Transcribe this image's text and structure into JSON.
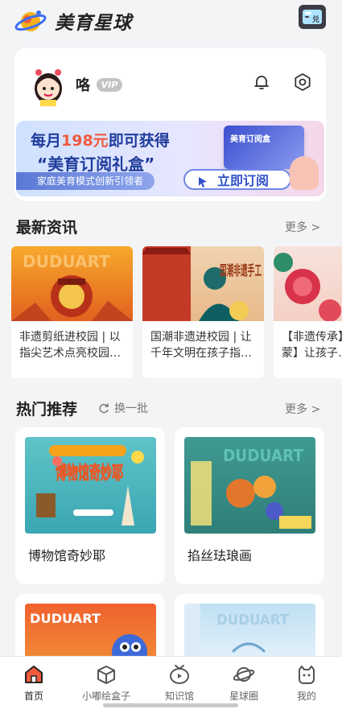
{
  "header": {
    "app_name": "美育星球",
    "redeem_label": "兑"
  },
  "profile": {
    "username": "咯",
    "vip_label": "VIP"
  },
  "banner": {
    "line1_prefix": "每月",
    "line1_highlight": "198元",
    "line1_suffix": "即可获得",
    "line2": "“美育订阅礼盒”",
    "subtitle": "家庭美育模式创新引领者",
    "cta": "立即订阅",
    "box_label": "美育订阅盒"
  },
  "news": {
    "title": "最新资讯",
    "more": "更多 >",
    "items": [
      {
        "title": "非遗剪纸进校园 | 以指尖艺术点亮校园…",
        "img_text": "DUDUART"
      },
      {
        "title": "国潮非遗进校园 | 让千年文明在孩子指…",
        "img_text": "国潮非遗手工"
      },
      {
        "title": "【非遗传承】让孩子蒙】让孩子…",
        "img_text": ""
      }
    ]
  },
  "recommend": {
    "title": "热门推荐",
    "refresh": "换一批",
    "more": "更多 >",
    "items": [
      {
        "title": "博物馆奇妙耶",
        "img_text": "博物馆奇妙耶"
      },
      {
        "title": "掐丝珐琅画",
        "img_text": "DUDUART"
      },
      {
        "title": "",
        "img_text": "DUDUART"
      },
      {
        "title": "",
        "img_text": "DUDUART"
      }
    ]
  },
  "tabs": [
    {
      "label": "首页",
      "icon": "home-icon",
      "active": true
    },
    {
      "label": "小嘟绘盒子",
      "icon": "box-icon",
      "active": false
    },
    {
      "label": "知识馆",
      "icon": "tv-icon",
      "active": false
    },
    {
      "label": "星球圈",
      "icon": "planet-icon",
      "active": false
    },
    {
      "label": "我的",
      "icon": "profile-icon",
      "active": false
    }
  ],
  "colors": {
    "accent_orange": "#f05a3e",
    "banner_blue": "#1f3c9b",
    "active_tab": "#f05a3e"
  }
}
